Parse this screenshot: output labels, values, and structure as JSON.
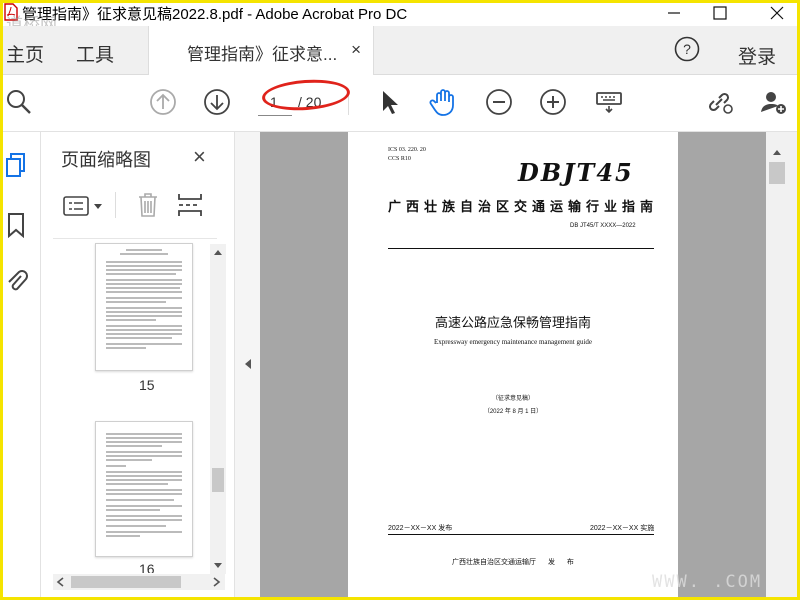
{
  "window": {
    "title": "管理指南》征求意见稿2022.8.pdf - Adobe Acrobat Pro DC",
    "watermark": "道桥网",
    "corner_watermark": "WWW.    .COM"
  },
  "menu": {
    "home": "主页",
    "tools": "工具",
    "sign_in": "登录"
  },
  "tab": {
    "label": "管理指南》征求意...",
    "close": "×"
  },
  "toolbar": {
    "current_page": "1",
    "total_pages": "/ 20"
  },
  "panel": {
    "title": "页面缩略图",
    "close": "×",
    "thumbnails": [
      {
        "page": "15"
      },
      {
        "page": "16"
      }
    ]
  },
  "document": {
    "ics": "ICS  03. 220. 20",
    "ccs": "CCS  R10",
    "logo": "DBJT45",
    "org": "广西壮族自治区交通运输行业指南",
    "doc_no": "DB JT45/T  XXXX—2022",
    "title_cn": "高速公路应急保畅管理指南",
    "title_en": "Expressway emergency maintenance management guide",
    "draft": "（征求意见稿）",
    "draft_date": "（2022 年 8 月 1 日）",
    "issue": "2022－XX－XX 发布",
    "effective": "2022－XX－XX 实施",
    "publisher": "广西壮族自治区交通运输厅    发  布"
  },
  "colors": {
    "accent": "#1473e6",
    "annotation": "#e0231b",
    "frame": "#f5e400",
    "doc_bg": "#a6a6a6"
  }
}
